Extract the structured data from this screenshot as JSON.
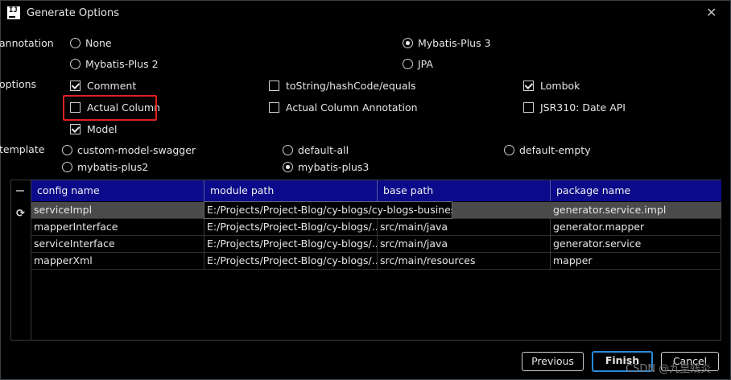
{
  "window": {
    "title": "Generate Options",
    "close_glyph": "✕",
    "logo_text": "IJ"
  },
  "annotation": {
    "label": "annotation",
    "options": [
      {
        "label": "None",
        "selected": false
      },
      {
        "label": "Mybatis-Plus 3",
        "selected": true
      },
      {
        "label": "Mybatis-Plus 2",
        "selected": false
      },
      {
        "label": "JPA",
        "selected": false
      }
    ]
  },
  "options": {
    "label": "options",
    "items": [
      {
        "label": "Comment",
        "checked": true
      },
      {
        "label": "toString/hashCode/equals",
        "checked": false
      },
      {
        "label": "Lombok",
        "checked": true
      },
      {
        "label": "Actual Column",
        "checked": false
      },
      {
        "label": "Actual Column Annotation",
        "checked": false
      },
      {
        "label": "JSR310: Date API",
        "checked": false
      },
      {
        "label": "Model",
        "checked": true
      }
    ]
  },
  "template": {
    "label": "template",
    "options": [
      {
        "label": "custom-model-swagger",
        "selected": false
      },
      {
        "label": "default-all",
        "selected": false
      },
      {
        "label": "default-empty",
        "selected": false
      },
      {
        "label": "mybatis-plus2",
        "selected": false
      },
      {
        "label": "mybatis-plus3",
        "selected": true
      }
    ]
  },
  "table": {
    "columns": [
      "config name",
      "module path",
      "base path",
      "package name"
    ],
    "rows": [
      [
        "serviceImpl",
        "E:/Projects/Project-Blog/cy-blogs/cy-blogs-business",
        "",
        "generator.service.impl"
      ],
      [
        "mapperInterface",
        "E:/Projects/Project-Blog/cy-blogs/...",
        "src/main/java",
        "generator.mapper"
      ],
      [
        "serviceInterface",
        "E:/Projects/Project-Blog/cy-blogs/...",
        "src/main/java",
        "generator.service"
      ],
      [
        "mapperXml",
        "E:/Projects/Project-Blog/cy-blogs/...",
        "src/main/resources",
        "mapper"
      ]
    ]
  },
  "buttons": {
    "previous": "Previous",
    "finish": "Finish",
    "cancel": "Cancel"
  },
  "watermark": "CSDN @九皇残炎",
  "colors": {
    "header_bg": "#0a0a8a",
    "selected_row": "#4a4a4a",
    "highlight_box": "#e02020",
    "primary_border": "#2a8ad8"
  }
}
